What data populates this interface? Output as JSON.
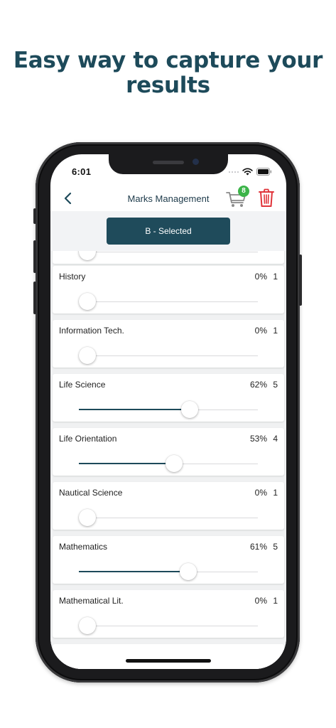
{
  "headline": {
    "line1": "Easy way to capture your",
    "line2": "results"
  },
  "status": {
    "time": "6:01"
  },
  "nav": {
    "title": "Marks Management",
    "cart_count": "8"
  },
  "selection": {
    "label": "B - Selected"
  },
  "colors": {
    "accent": "#1d4a5a",
    "badge": "#3cb449",
    "delete": "#e0343a"
  },
  "icons": {
    "back": "chevron-left-icon",
    "cart": "cart-icon",
    "delete": "trash-icon"
  },
  "subjects": [
    {
      "name": "History",
      "percent": "0%",
      "grade": "1",
      "value": 0
    },
    {
      "name": "Information Tech.",
      "percent": "0%",
      "grade": "1",
      "value": 0
    },
    {
      "name": "Life Science",
      "percent": "62%",
      "grade": "5",
      "value": 62
    },
    {
      "name": "Life Orientation",
      "percent": "53%",
      "grade": "4",
      "value": 53
    },
    {
      "name": "Nautical Science",
      "percent": "0%",
      "grade": "1",
      "value": 0
    },
    {
      "name": "Mathematics",
      "percent": "61%",
      "grade": "5",
      "value": 61
    },
    {
      "name": "Mathematical Lit.",
      "percent": "0%",
      "grade": "1",
      "value": 0
    }
  ]
}
